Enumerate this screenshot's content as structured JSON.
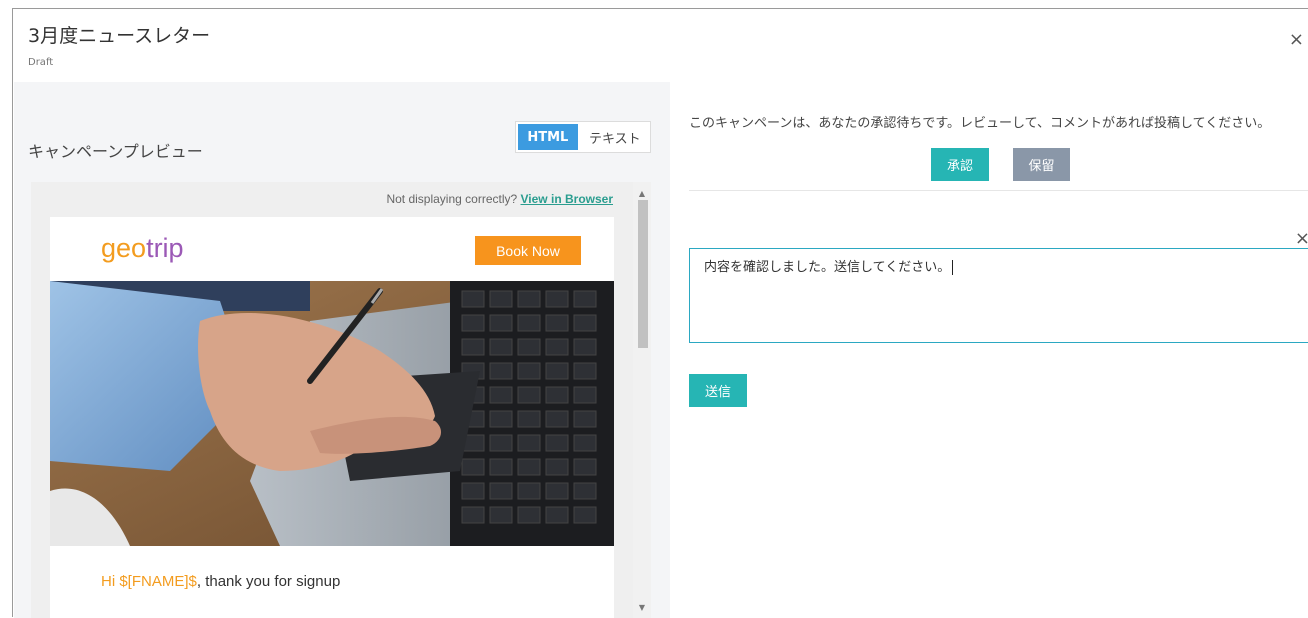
{
  "modal": {
    "title": "3月度ニュースレター",
    "status": "Draft",
    "close_icon": "×"
  },
  "preview": {
    "heading": "キャンペーンプレビュー",
    "tabs": [
      {
        "label": "HTML",
        "active": true
      },
      {
        "label": "テキスト",
        "active": false
      }
    ],
    "notice_text": "Not displaying correctly?",
    "notice_link": "View in Browser",
    "email": {
      "logo_part1": "geo",
      "logo_part2": "trip",
      "book_button": "Book Now",
      "greeting_var": "Hi $[FNAME]$",
      "greeting_rest": ", thank you for signup"
    }
  },
  "review": {
    "message": "このキャンペーンは、あなたの承認待ちです。レビューして、コメントがあれば投稿してください。",
    "approve_label": "承認",
    "hold_label": "保留",
    "comment_value": "内容を確認しました。送信してください。",
    "close_icon": "×",
    "send_label": "送信"
  },
  "colors": {
    "accent_teal": "#26b5b4",
    "hold_gray": "#8a97a8",
    "html_tab_blue": "#3c9be0",
    "brand_orange": "#f7941d",
    "brand_purple": "#9b59b6"
  }
}
